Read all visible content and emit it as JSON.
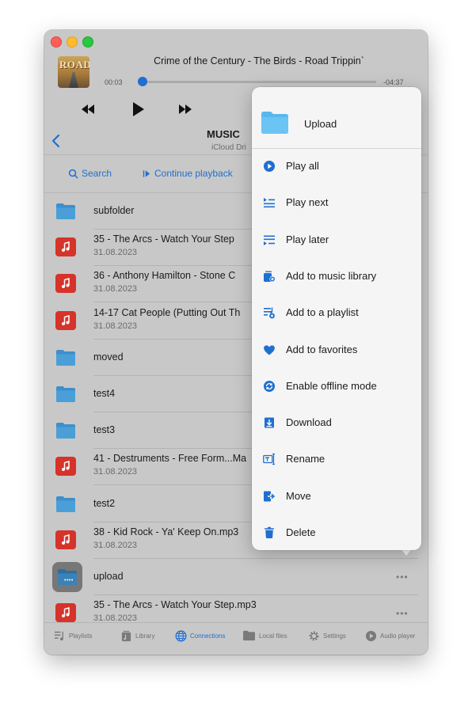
{
  "colors": {
    "accent": "#1f6fd0",
    "music_icon": "#d6332a",
    "folder": "#3d8fcb",
    "menu_folder": "#5ab7ee"
  },
  "player": {
    "track_title": "Crime of the Century - The Birds - Road Trippin`",
    "artwork_text": "ROAD",
    "elapsed": "00:03",
    "remaining": "-04:37",
    "progress_fraction": 0.01
  },
  "header": {
    "title": "MUSIC",
    "subtitle": "iCloud Dri"
  },
  "toolbar": {
    "search_label": "Search",
    "continue_label": "Continue playback"
  },
  "items": [
    {
      "type": "folder",
      "title": "subfolder"
    },
    {
      "type": "file",
      "title": "35 - The Arcs - Watch Your Step",
      "date": "31.08.2023"
    },
    {
      "type": "file",
      "title": "36 - Anthony Hamilton - Stone C",
      "date": "31.08.2023"
    },
    {
      "type": "file",
      "title": "14-17 Cat People (Putting Out Th",
      "date": "31.08.2023"
    },
    {
      "type": "folder",
      "title": "moved"
    },
    {
      "type": "folder",
      "title": "test4"
    },
    {
      "type": "folder",
      "title": "test3"
    },
    {
      "type": "file",
      "title": "41 - Destruments - Free Form...Ma",
      "date": "31.08.2023"
    },
    {
      "type": "folder",
      "title": "test2"
    },
    {
      "type": "file",
      "title": "38 - Kid Rock - Ya' Keep On.mp3",
      "date": "31.08.2023"
    },
    {
      "type": "folder",
      "title": "upload",
      "selected": true,
      "more": "•••"
    },
    {
      "type": "file",
      "title": "35 - The Arcs - Watch Your Step.mp3",
      "date": "31.08.2023",
      "more": "•••"
    }
  ],
  "context_menu": {
    "title": "Upload",
    "items": [
      {
        "label": "Play all",
        "icon": "play-circle-icon"
      },
      {
        "label": "Play next",
        "icon": "play-next-icon"
      },
      {
        "label": "Play later",
        "icon": "play-later-icon"
      },
      {
        "label": "Add to music library",
        "icon": "add-to-library-icon"
      },
      {
        "label": "Add to a playlist",
        "icon": "add-to-playlist-icon"
      },
      {
        "label": "Add to favorites",
        "icon": "heart-icon"
      },
      {
        "label": "Enable offline mode",
        "icon": "offline-sync-icon"
      },
      {
        "label": "Download",
        "icon": "download-icon"
      },
      {
        "label": "Rename",
        "icon": "rename-icon"
      },
      {
        "label": "Move",
        "icon": "move-icon"
      },
      {
        "label": "Delete",
        "icon": "trash-icon"
      }
    ]
  },
  "tabs": [
    {
      "label": "Playlists",
      "icon": "playlists-icon",
      "active": false
    },
    {
      "label": "Library",
      "icon": "library-icon",
      "active": false
    },
    {
      "label": "Connections",
      "icon": "globe-icon",
      "active": true
    },
    {
      "label": "Local files",
      "icon": "folder-icon",
      "active": false
    },
    {
      "label": "Settings",
      "icon": "gear-icon",
      "active": false
    },
    {
      "label": "Audio player",
      "icon": "play-circle-icon",
      "active": false
    }
  ]
}
